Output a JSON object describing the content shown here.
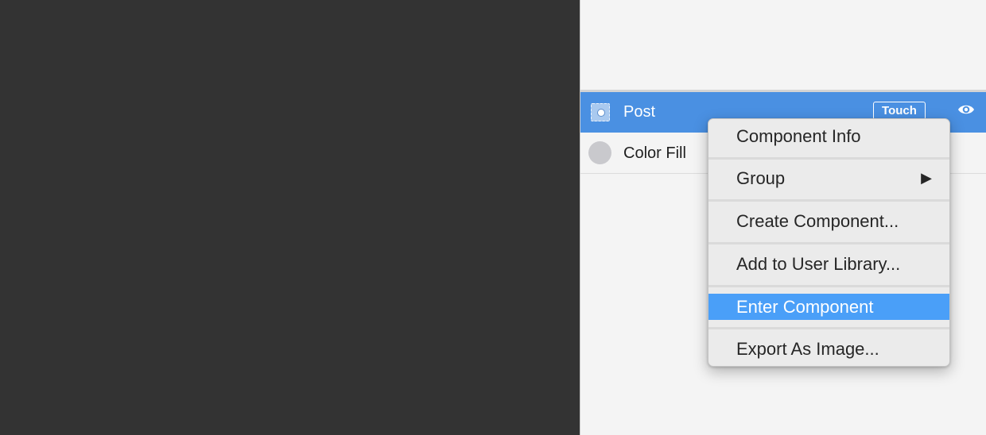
{
  "layers": {
    "selected_row": {
      "icon": "component-icon",
      "label": "Post",
      "badge": "Touch",
      "visibility_icon": "eye-icon"
    },
    "fill_row": {
      "icon": "color-swatch",
      "label": "Color Fill",
      "swatch_color": "#c9c9cd"
    }
  },
  "context_menu": {
    "items": [
      {
        "label": "Component Info",
        "highlighted": false
      },
      {
        "label": "Group",
        "submenu": true,
        "arrow": "▶",
        "highlighted": false
      },
      {
        "label": "Create Component...",
        "highlighted": false
      },
      {
        "label": "Add to User Library...",
        "highlighted": false
      },
      {
        "label": "Enter Component",
        "highlighted": true
      },
      {
        "label": "Export As Image...",
        "highlighted": false
      }
    ]
  },
  "colors": {
    "canvas": "#333333",
    "panel": "#f4f4f4",
    "selection": "#4a90e2",
    "menu_highlight": "#4a9ff8"
  }
}
